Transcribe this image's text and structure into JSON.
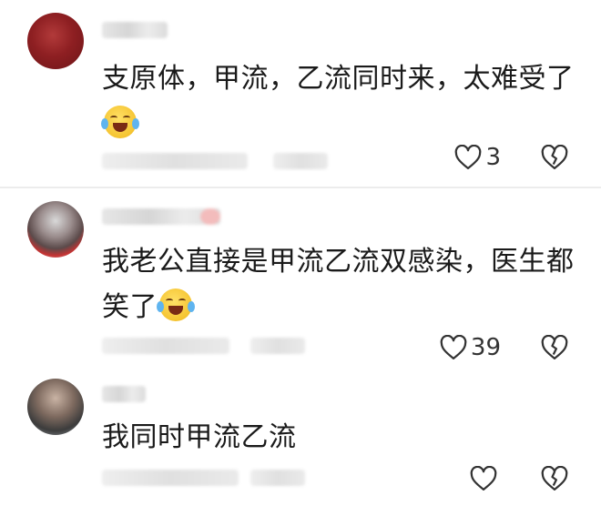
{
  "comments": [
    {
      "text": "支原体，甲流，乙流同时来，太难受了",
      "emoji": "crying-laughing-emoji",
      "likes": "3"
    },
    {
      "text": "我老公直接是甲流乙流双感染，医生都笑了",
      "emoji": "crying-laughing-emoji",
      "likes": "39"
    },
    {
      "text": "我同时甲流乙流",
      "likes": ""
    }
  ],
  "icons": {
    "like": "heart-outline-icon",
    "dislike": "broken-heart-icon"
  },
  "colors": {
    "background": "#ffffff",
    "text": "#1a1a1a",
    "icon": "#333333",
    "divider": "#ececec"
  }
}
